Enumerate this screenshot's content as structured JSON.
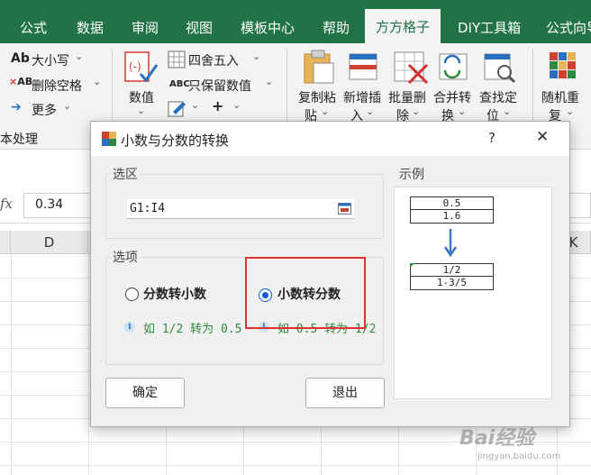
{
  "ribbon_tabs": [
    {
      "label": "公式"
    },
    {
      "label": "数据"
    },
    {
      "label": "审阅"
    },
    {
      "label": "视图"
    },
    {
      "label": "模板中心"
    },
    {
      "label": "帮助"
    },
    {
      "label": "方方格子"
    },
    {
      "label": "DIY工具箱"
    },
    {
      "label": "公式向导"
    }
  ],
  "ribbon": {
    "text_group": {
      "case_label": "大小写",
      "remove_spaces_label": "删除空格",
      "more_label": "更多",
      "group_label": "本处理"
    },
    "number_group": {
      "value_label": "数值",
      "round_label": "四舍五入",
      "keep_values_label": "只保留数值",
      "abc_label": "ABC"
    },
    "big_buttons": [
      {
        "line1": "复制粘",
        "line2": "贴"
      },
      {
        "line1": "新增插",
        "line2": "入"
      },
      {
        "line1": "批量删",
        "line2": "除"
      },
      {
        "line1": "合并转",
        "line2": "换"
      },
      {
        "line1": "查找定",
        "line2": "位"
      },
      {
        "line1": "随机重",
        "line2": "复"
      }
    ]
  },
  "formula_bar": {
    "fx": "fx",
    "value": "0.34"
  },
  "grid": {
    "columns": [
      "D",
      "K"
    ]
  },
  "dialog": {
    "title": "小数与分数的转换",
    "help": "?",
    "close": "✕",
    "range_group_label": "选区",
    "range_value": "G1:I4",
    "options_group_label": "选项",
    "option_frac_to_dec": "分数转小数",
    "option_dec_to_frac": "小数转分数",
    "hint_frac_to_dec": "如 1/2 转为 0.5",
    "hint_dec_to_frac": "如 0.5 转为 1/2",
    "example_label": "示例",
    "example_before": [
      "0.5",
      "1.6"
    ],
    "example_after": [
      "1/2",
      "1-3/5"
    ],
    "ok_label": "确定",
    "exit_label": "退出"
  },
  "watermark": {
    "brand": "Bai经验",
    "url": "jingyan.baidu.com"
  },
  "colors": {
    "excel_green": "#217346",
    "highlight_red": "#e03030",
    "radio_blue": "#0a5ad6",
    "hint_green": "#2e8b3a"
  }
}
